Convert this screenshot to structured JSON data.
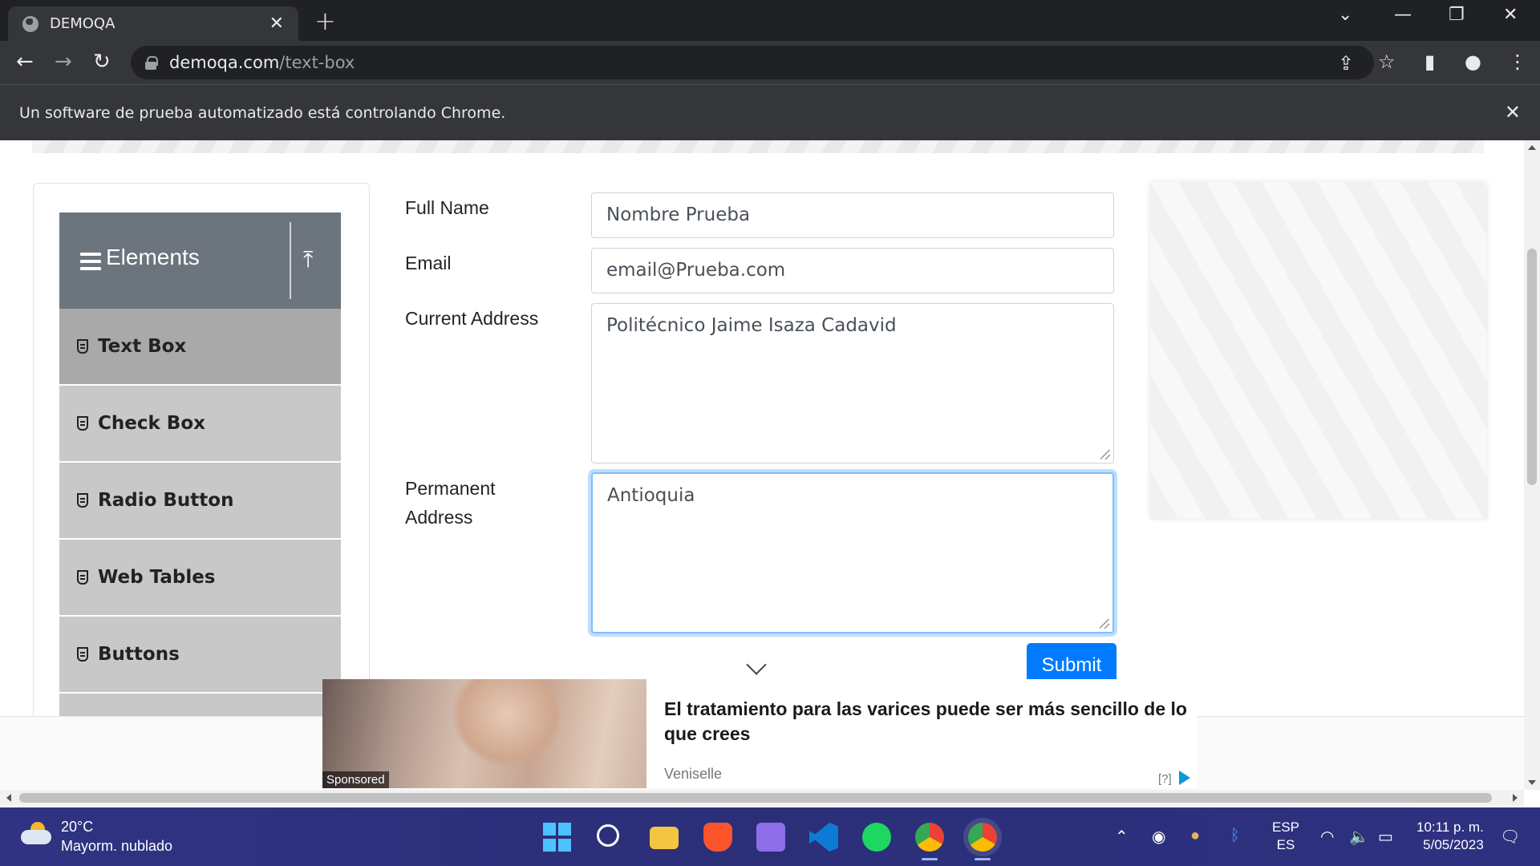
{
  "browser": {
    "tab_title": "DEMOQA",
    "tab_close": "✕",
    "new_tab": "+",
    "url_host": "demoqa.com",
    "url_path": "/text-box",
    "infobar_text": "Un software de prueba automatizado está controlando Chrome.",
    "infobar_close": "✕"
  },
  "sidebar": {
    "group_title": "Elements",
    "items": [
      {
        "label": "Text Box"
      },
      {
        "label": "Check Box"
      },
      {
        "label": "Radio Button"
      },
      {
        "label": "Web Tables"
      },
      {
        "label": "Buttons"
      }
    ]
  },
  "form": {
    "full_name_label": "Full Name",
    "full_name_value": "Nombre Prueba",
    "email_label": "Email",
    "email_value": "email@Prueba.com",
    "current_address_label": "Current Address",
    "current_address_value": "Politécnico Jaime Isaza Cadavid",
    "permanent_address_label_1": "Permanent",
    "permanent_address_label_2": "Address",
    "permanent_address_value": "Antioquia",
    "submit_label": "Submit"
  },
  "ad": {
    "sponsored": "Sponsored",
    "title": "El tratamiento para las varices puede ser más sencillo de lo que crees",
    "source": "Veniselle",
    "info": "[?]"
  },
  "taskbar": {
    "temperature": "20°C",
    "weather": "Mayorm. nublado",
    "lang_1": "ESP",
    "lang_2": "ES",
    "time": "10:11 p. m.",
    "date": "5/05/2023"
  },
  "colors": {
    "primary": "#007bff",
    "sidebar_header": "#6c757d",
    "menu_item": "#c8c8c8",
    "menu_item_active": "#a9a9a9",
    "chrome_dark": "#202124",
    "taskbar": "#2c2f7a"
  }
}
